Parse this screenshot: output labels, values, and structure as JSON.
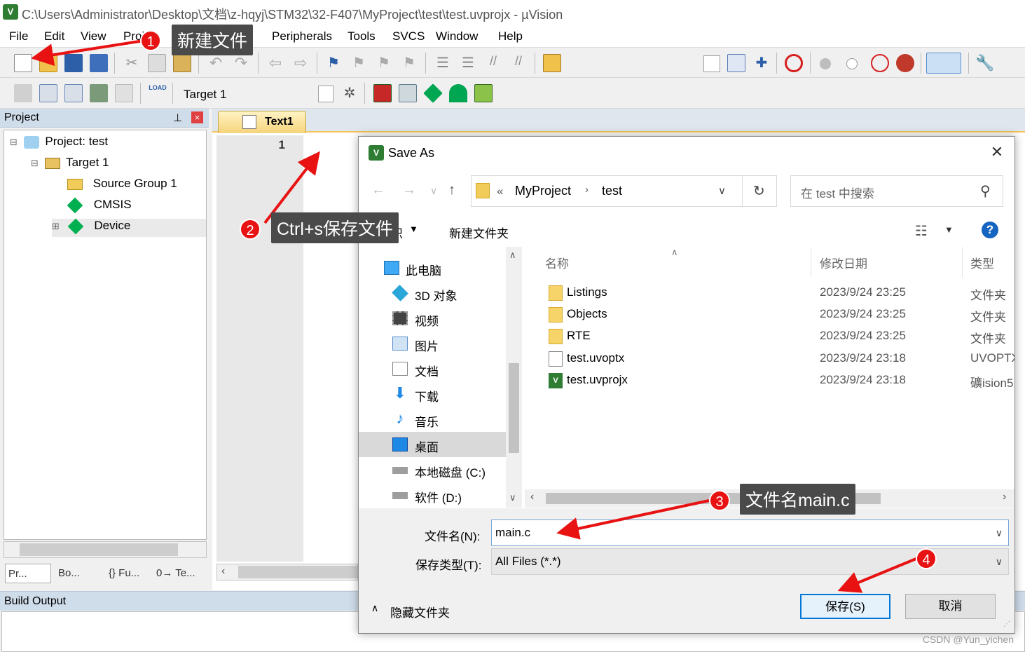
{
  "window": {
    "title": "C:\\Users\\Administrator\\Desktop\\文档\\z-hqyj\\STM32\\32-F407\\MyProject\\test\\test.uvprojx - µVision",
    "app_icon": "uv"
  },
  "menu": [
    "File",
    "Edit",
    "View",
    "Proj",
    "ug",
    "Peripherals",
    "Tools",
    "SVCS",
    "Window",
    "Help"
  ],
  "toolbar2": {
    "target": "Target 1"
  },
  "project_panel": {
    "title": "Project",
    "tree": [
      "Project: test",
      "Target 1",
      "Source Group 1",
      "CMSIS",
      "Device"
    ],
    "bottom_tabs": [
      "Pr...",
      "Bo...",
      "{} Fu...",
      "0→ Te..."
    ]
  },
  "editor": {
    "tab": "Text1",
    "line_number": "1"
  },
  "build_output": {
    "title": "Build Output"
  },
  "dialog": {
    "title": "Save As",
    "icon": "uv",
    "address": [
      "«",
      "MyProject",
      "test"
    ],
    "search_placeholder": "在 test 中搜索",
    "new_folder": "新建文件夹",
    "organize_fragment": "织",
    "nav_items": [
      "此电脑",
      "3D 对象",
      "视频",
      "图片",
      "文档",
      "下载",
      "音乐",
      "桌面",
      "本地磁盘 (C:)",
      "软件 (D:)"
    ],
    "columns": {
      "name": "名称",
      "date": "修改日期",
      "type": "类型"
    },
    "files": [
      {
        "name": "Listings",
        "date": "2023/9/24 23:25",
        "type": "文件夹",
        "kind": "folder"
      },
      {
        "name": "Objects",
        "date": "2023/9/24 23:25",
        "type": "文件夹",
        "kind": "folder"
      },
      {
        "name": "RTE",
        "date": "2023/9/24 23:25",
        "type": "文件夹",
        "kind": "folder"
      },
      {
        "name": "test.uvoptx",
        "date": "2023/9/24 23:18",
        "type": "UVOPTX",
        "kind": "file"
      },
      {
        "name": "test.uvprojx",
        "date": "2023/9/24 23:18",
        "type": "礦ision5",
        "kind": "uvproj"
      }
    ],
    "filename_label": "文件名(N):",
    "filename_value": "main.c",
    "filetype_label": "保存类型(T):",
    "filetype_value": "All Files (*.*)",
    "hide_folders": "隐藏文件夹",
    "save_button": "保存(S)",
    "cancel_button": "取消"
  },
  "annotations": [
    {
      "num": "1",
      "text": "新建文件"
    },
    {
      "num": "2",
      "text": "Ctrl+s保存文件"
    },
    {
      "num": "3",
      "text": "文件名main.c"
    },
    {
      "num": "4",
      "text": ""
    }
  ],
  "watermark": "CSDN @Yun_yichen",
  "colors": {
    "annotation_red": "#e81212",
    "callout_bg": "#4a4a4a",
    "panel_header": "#cfdcea",
    "accent_blue": "#0078d7"
  }
}
